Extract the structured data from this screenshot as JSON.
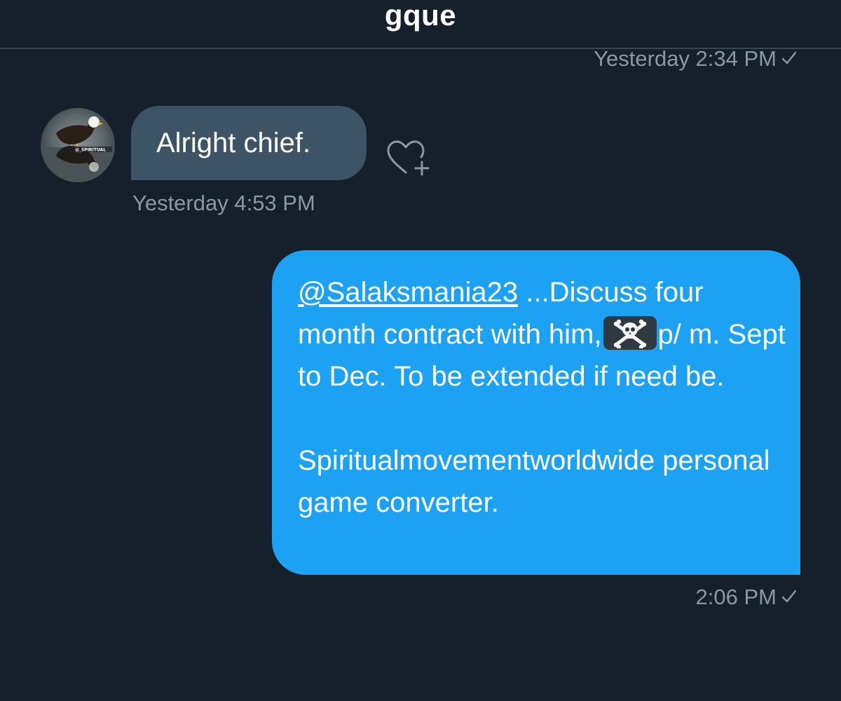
{
  "header": {
    "title": "gque"
  },
  "messages": {
    "top_timestamp": "Yesterday 2:34 PM",
    "received": {
      "text": "Alright chief.",
      "timestamp": "Yesterday 4:53 PM",
      "avatar_watermark": "@_SPIRITUAL"
    },
    "sent": {
      "mention": "@Salaksmania23",
      "text_part1": " ...Discuss four month contract with him,",
      "emoji": "skull-and-crossbones",
      "text_part2": "p/ m. Sept to Dec. To be extended if need be.",
      "paragraph2": "Spiritualmovementworldwide personal game converter.",
      "timestamp": "2:06 PM"
    }
  },
  "icons": {
    "read_receipt": "check-icon",
    "like": "heart-plus-icon"
  },
  "colors": {
    "background": "#15202b",
    "received_bubble": "#3d5466",
    "sent_bubble": "#1da1f2",
    "meta_text": "#8899a6",
    "divider": "#38444d"
  }
}
